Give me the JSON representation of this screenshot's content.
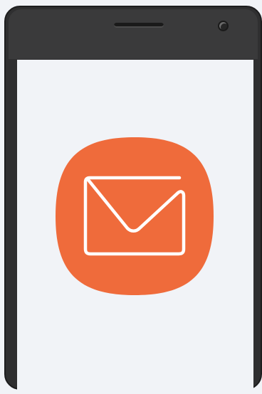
{
  "device": {
    "frame_color": "#2f2f30",
    "screen_color": "#f1f3f7"
  },
  "app_icon": {
    "icon": "mail-icon",
    "background_color": "#ef6b3b",
    "stroke_color": "#ffffff"
  }
}
